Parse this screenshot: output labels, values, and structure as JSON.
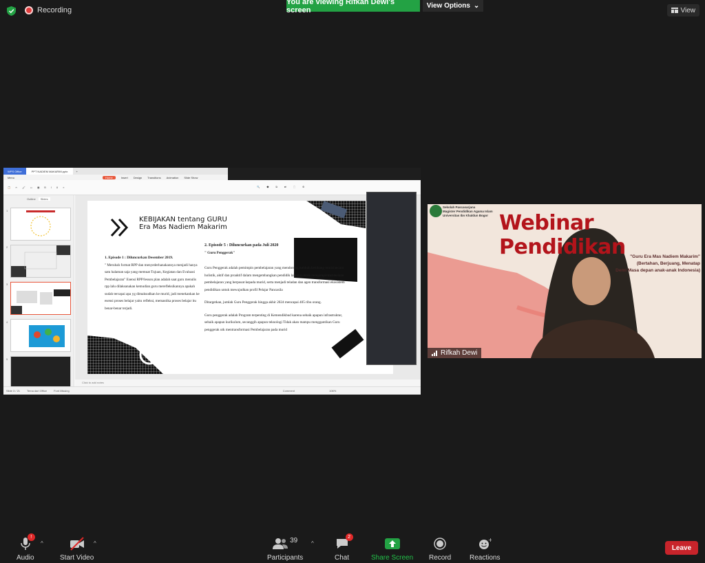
{
  "top": {
    "recording_label": "Recording",
    "banner_text": "You are viewing Rifkah Dewi's screen",
    "view_options_label": "View Options",
    "view_label": "View"
  },
  "share": {
    "tabs": [
      "WPS Office",
      "PPT NADIEM MAKARIM.pptx"
    ],
    "menu": [
      "Menu",
      "Home",
      "Insert",
      "Design",
      "Transitions",
      "Animation",
      "Slide Show"
    ],
    "thumb_tabs": [
      "Outline",
      "Slides"
    ],
    "notes_placeholder": "Click to add notes",
    "status_left": "Slide 3 / 21",
    "status_theme": "Tema dari Office",
    "status_fonts": "Font Missing",
    "zoom": "106%",
    "comment": "Comment"
  },
  "slide": {
    "title_line1": "KEBIJAKAN tentang GURU",
    "title_line2": "Era Mas Nadiem Makarim",
    "ep1_heading": "1. Episode 1 : Diluncurkan Desember 2019.",
    "ep1_body": "\" Merubah format RPP dan menyederhanakannya menjadi hanya satu halaman saja yang memuat Tujuan, Kegiatan dan Evaluasi Pembelajaran\" Esensi RPP/lesson plan adalah saat guru menulis rpp lalu dilaksanakan kemudian guru merefleksikannya apakah sudah tercapai apa yg dimaksudkan ke murid, jadi menekankan ke esensi proses belajar yaitu refleksi, memastika proses belajar itu benar-benar terjadi.",
    "ep2_heading": "2. Episode 5 : Diluncurkan pada Juli 2020",
    "ep2_sub": "\" Guru Penggerak\"",
    "ep2_p1": "Guru Penggerak adalah pemimpin pembelajaran yang mendorong tumbuh kembang murid secara holistik, aktif dan proaktif dalam mengembangkan pendidik lainnya untuk mengimplementasikan pembelajaran yang berpusat kepada murid, serta menjadi teladan dan agen transformasi ekosistem pendidikan untuk mewujudkan profil Pelajar Pancasila",
    "ep2_p2": "Ditargetkan, jumlah Guru Penggerak hingga akhir 2024 mencapai 405 ribu orang.",
    "ep2_p3": "Guru penggerak adalah Program terpenting di Kemendikbud karena sebaik apapun infrastruktur, sebaik apapun kurikulum, secanggih apapun teknologi Tidak akan mampu menggantikan Guru penggerak utk mentransformasi Pembelajaran pada murid"
  },
  "video": {
    "org_line1": "Sekolah Pascasarjana",
    "org_line2": "Magister Pendidikan Agama Islam",
    "org_line3": "Universitas Ibn Khaldun Bogor",
    "title": "Webinar Pendidikan",
    "sub1": "\"Guru Era Mas Nadiem Makarim\"",
    "sub2": "(Bertahan, Berjuang, Menatap",
    "sub3": "Demi Masa depan anak-anak Indonesia)",
    "participant_name": "Rifkah Dewi"
  },
  "toolbar": {
    "audio": "Audio",
    "audio_badge": "!",
    "start_video": "Start Video",
    "participants": "Participants",
    "participants_count": "39",
    "chat": "Chat",
    "chat_badge": "2",
    "share_screen": "Share Screen",
    "record": "Record",
    "reactions": "Reactions",
    "leave": "Leave"
  },
  "colors": {
    "share_green": "#23a244",
    "leave_red": "#c8242b",
    "accent_orange": "#e8563a"
  }
}
